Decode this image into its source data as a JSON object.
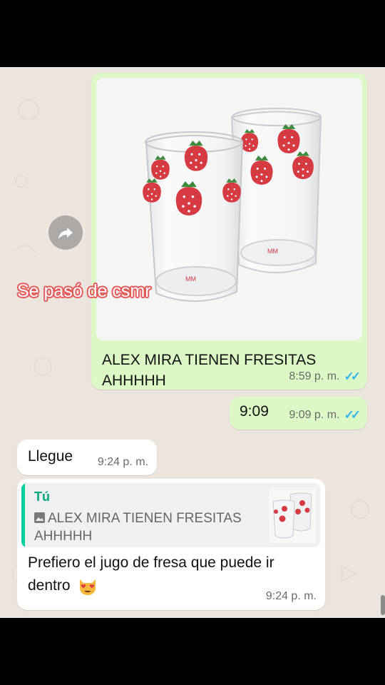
{
  "overlay": {
    "text": "Se pasó de csmr"
  },
  "messages": {
    "image_message": {
      "caption": "ALEX MIRA TIENEN FRESITAS AHHHHH",
      "time": "8:59 p. m.",
      "status": "read",
      "photo_description_icon": "strawberry-glasses-photo"
    },
    "time_message": {
      "text": "9:09",
      "time": "9:09 p. m.",
      "status": "read"
    },
    "incoming_1": {
      "text": "Llegue",
      "time": "9:24 p. m."
    },
    "incoming_reply": {
      "quote_author": "Tú",
      "quote_text": "ALEX MIRA TIENEN FRESITAS AHHHHH",
      "text": "Prefiero el jugo de fresa que puede ir dentro",
      "time": "9:24 p. m.",
      "emoji_icon": "heart-eyes-cat-emoji"
    }
  },
  "colors": {
    "chat_background": "#ece5dd",
    "outgoing_bubble": "#dcf8c6",
    "incoming_bubble": "#ffffff",
    "read_ticks": "#34b7f1",
    "quote_accent": "#06cf9c",
    "strawberry": "#d63b43"
  }
}
